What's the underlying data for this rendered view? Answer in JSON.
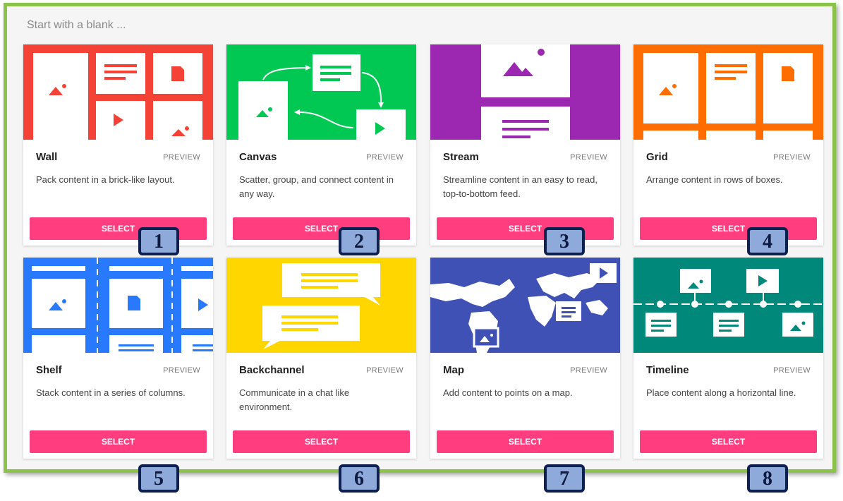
{
  "heading": "Start with a blank ...",
  "cards": [
    {
      "title": "Wall",
      "preview": "PREVIEW",
      "desc": "Pack content in a brick-like layout.",
      "select": "SELECT",
      "color": "#f44336"
    },
    {
      "title": "Canvas",
      "preview": "PREVIEW",
      "desc": "Scatter, group, and connect content in any way.",
      "select": "SELECT",
      "color": "#00c853"
    },
    {
      "title": "Stream",
      "preview": "PREVIEW",
      "desc": "Streamline content in an easy to read, top-to-bottom feed.",
      "select": "SELECT",
      "color": "#9c27b0"
    },
    {
      "title": "Grid",
      "preview": "PREVIEW",
      "desc": "Arrange content in rows of boxes.",
      "select": "SELECT",
      "color": "#ff6d00"
    },
    {
      "title": "Shelf",
      "preview": "PREVIEW",
      "desc": "Stack content in a series of columns.",
      "select": "SELECT",
      "color": "#2979ff"
    },
    {
      "title": "Backchannel",
      "preview": "PREVIEW",
      "desc": "Communicate in a chat like environment.",
      "select": "SELECT",
      "color": "#ffd600"
    },
    {
      "title": "Map",
      "preview": "PREVIEW",
      "desc": "Add content to points on a map.",
      "select": "SELECT",
      "color": "#3f51b5"
    },
    {
      "title": "Timeline",
      "preview": "PREVIEW",
      "desc": "Place content along a horizontal line.",
      "select": "SELECT",
      "color": "#00897b"
    }
  ],
  "badges": [
    "1",
    "2",
    "3",
    "4",
    "5",
    "6",
    "7",
    "8"
  ]
}
